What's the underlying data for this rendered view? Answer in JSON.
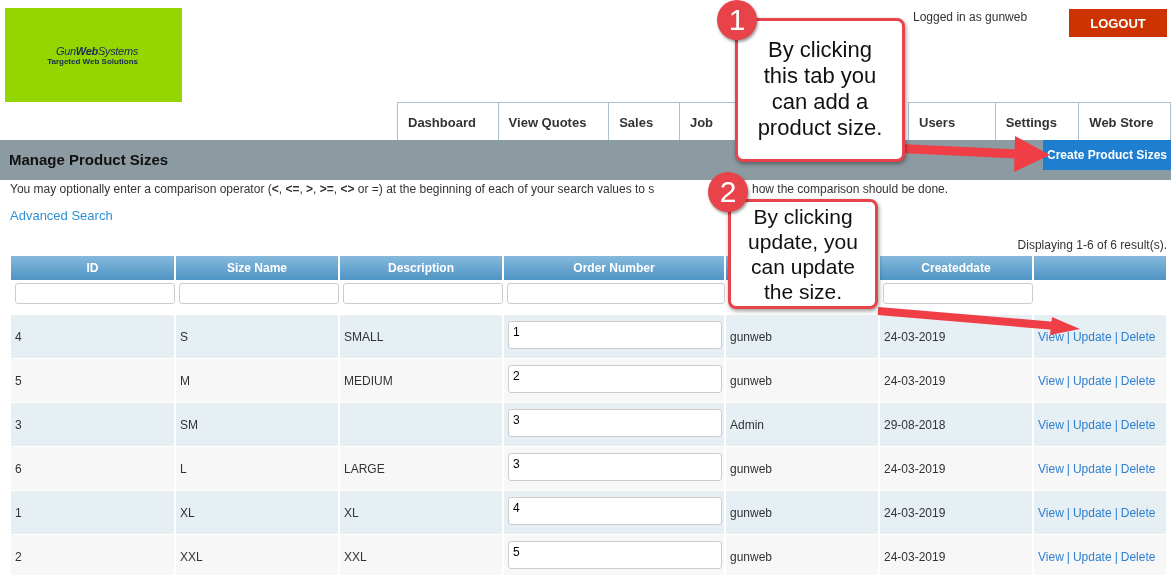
{
  "logo": {
    "name": "Gun**Web**Systems",
    "tagline": "Targeted Web Solutions"
  },
  "login_text": "Logged in as gunweb",
  "logout": "LOGOUT",
  "tabs": [
    {
      "label": "Dashboard"
    },
    {
      "label": "View Quotes"
    },
    {
      "label": "Sales"
    },
    {
      "label": "Job"
    },
    {
      "label": "Users"
    },
    {
      "label": "Settings"
    },
    {
      "label": "Web Store"
    }
  ],
  "page": {
    "title": "Manage Product Sizes",
    "create_button": "Create Product Sizes",
    "hint_parts": [
      "You may optionally enter a comparison operator (**<**, **<=**, **>**, **>=**, **<>** or =) at the beginning of each of your search values to s",
      "how the comparison should be done."
    ],
    "advanced_search": "Advanced Search",
    "summary": "Displaying 1-6 of 6 result(s)."
  },
  "table": {
    "columns": [
      {
        "label": "ID"
      },
      {
        "label": "Size Name"
      },
      {
        "label": "Description"
      },
      {
        "label": "Order Number"
      },
      {},
      {
        "label": "Createddate"
      },
      {}
    ],
    "separator": "|",
    "rows": [
      {
        "id": "4",
        "size_name": "S",
        "description": "SMALL",
        "order_number": "1",
        "created_by": "gunweb",
        "created_date": "24-03-2019",
        "actions": [
          "View",
          "Update",
          "Delete"
        ]
      },
      {
        "id": "5",
        "size_name": "M",
        "description": "MEDIUM",
        "order_number": "2",
        "created_by": "gunweb",
        "created_date": "24-03-2019",
        "actions": [
          "View",
          "Update",
          "Delete"
        ]
      },
      {
        "id": "3",
        "size_name": "SM",
        "order_number": "3",
        "created_by": "Admin",
        "created_date": "29-08-2018",
        "actions": [
          "View",
          "Update",
          "Delete"
        ]
      },
      {
        "id": "6",
        "size_name": "L",
        "description": "LARGE",
        "order_number": "3",
        "created_by": "gunweb",
        "created_date": "24-03-2019",
        "actions": [
          "View",
          "Update",
          "Delete"
        ]
      },
      {
        "id": "1",
        "size_name": "XL",
        "description": "XL",
        "order_number": "4",
        "created_by": "gunweb",
        "created_date": "24-03-2019",
        "actions": [
          "View",
          "Update",
          "Delete"
        ]
      },
      {
        "id": "2",
        "size_name": "XXL",
        "description": "XXL",
        "order_number": "5",
        "created_by": "gunweb",
        "created_date": "24-03-2019",
        "actions": [
          "View",
          "Update",
          "Delete"
        ]
      }
    ]
  },
  "callouts": [
    {
      "number": "1",
      "text": "By clicking this tab you can add a product size."
    },
    {
      "number": "2",
      "text": "By clicking update, you can update the size."
    }
  ]
}
